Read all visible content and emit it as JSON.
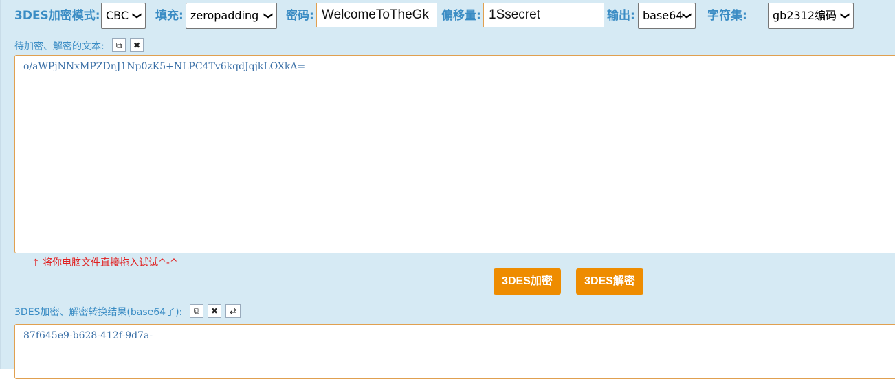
{
  "options": {
    "mode_label": "3DES加密模式:",
    "mode_value": "CBC",
    "padding_label": "填充:",
    "padding_value": "zeropadding",
    "password_label": "密码:",
    "password_value": "WelcomeToTheGk",
    "offset_label": "偏移量:",
    "offset_value": "1Ssecret",
    "output_label": "输出:",
    "output_value": "base64",
    "charset_label": "字符集:",
    "charset_value": "gb2312编码"
  },
  "input_section": {
    "label": "待加密、解密的文本:",
    "text": "o/aWPjNNxMPZDnJ1Np0zK5+NLPC4Tv6kqdJqjkLOXkA=",
    "hint": "↑ 将你电脑文件直接拖入试试^-^"
  },
  "actions": {
    "encrypt_label": "3DES加密",
    "decrypt_label": "3DES解密"
  },
  "output_section": {
    "label": "3DES加密、解密转换结果(base64了):",
    "text": "87f645e9-b628-412f-9d7a-"
  },
  "icons": {
    "copy": "copy-icon",
    "clear": "close-icon",
    "swap": "swap-icon"
  },
  "colors": {
    "label_blue": "#3a8cc4",
    "button_orange": "#ee8c00",
    "panel_bg": "#d6eaf4",
    "input_border": "#e0a050",
    "hint_red": "#e02020"
  }
}
